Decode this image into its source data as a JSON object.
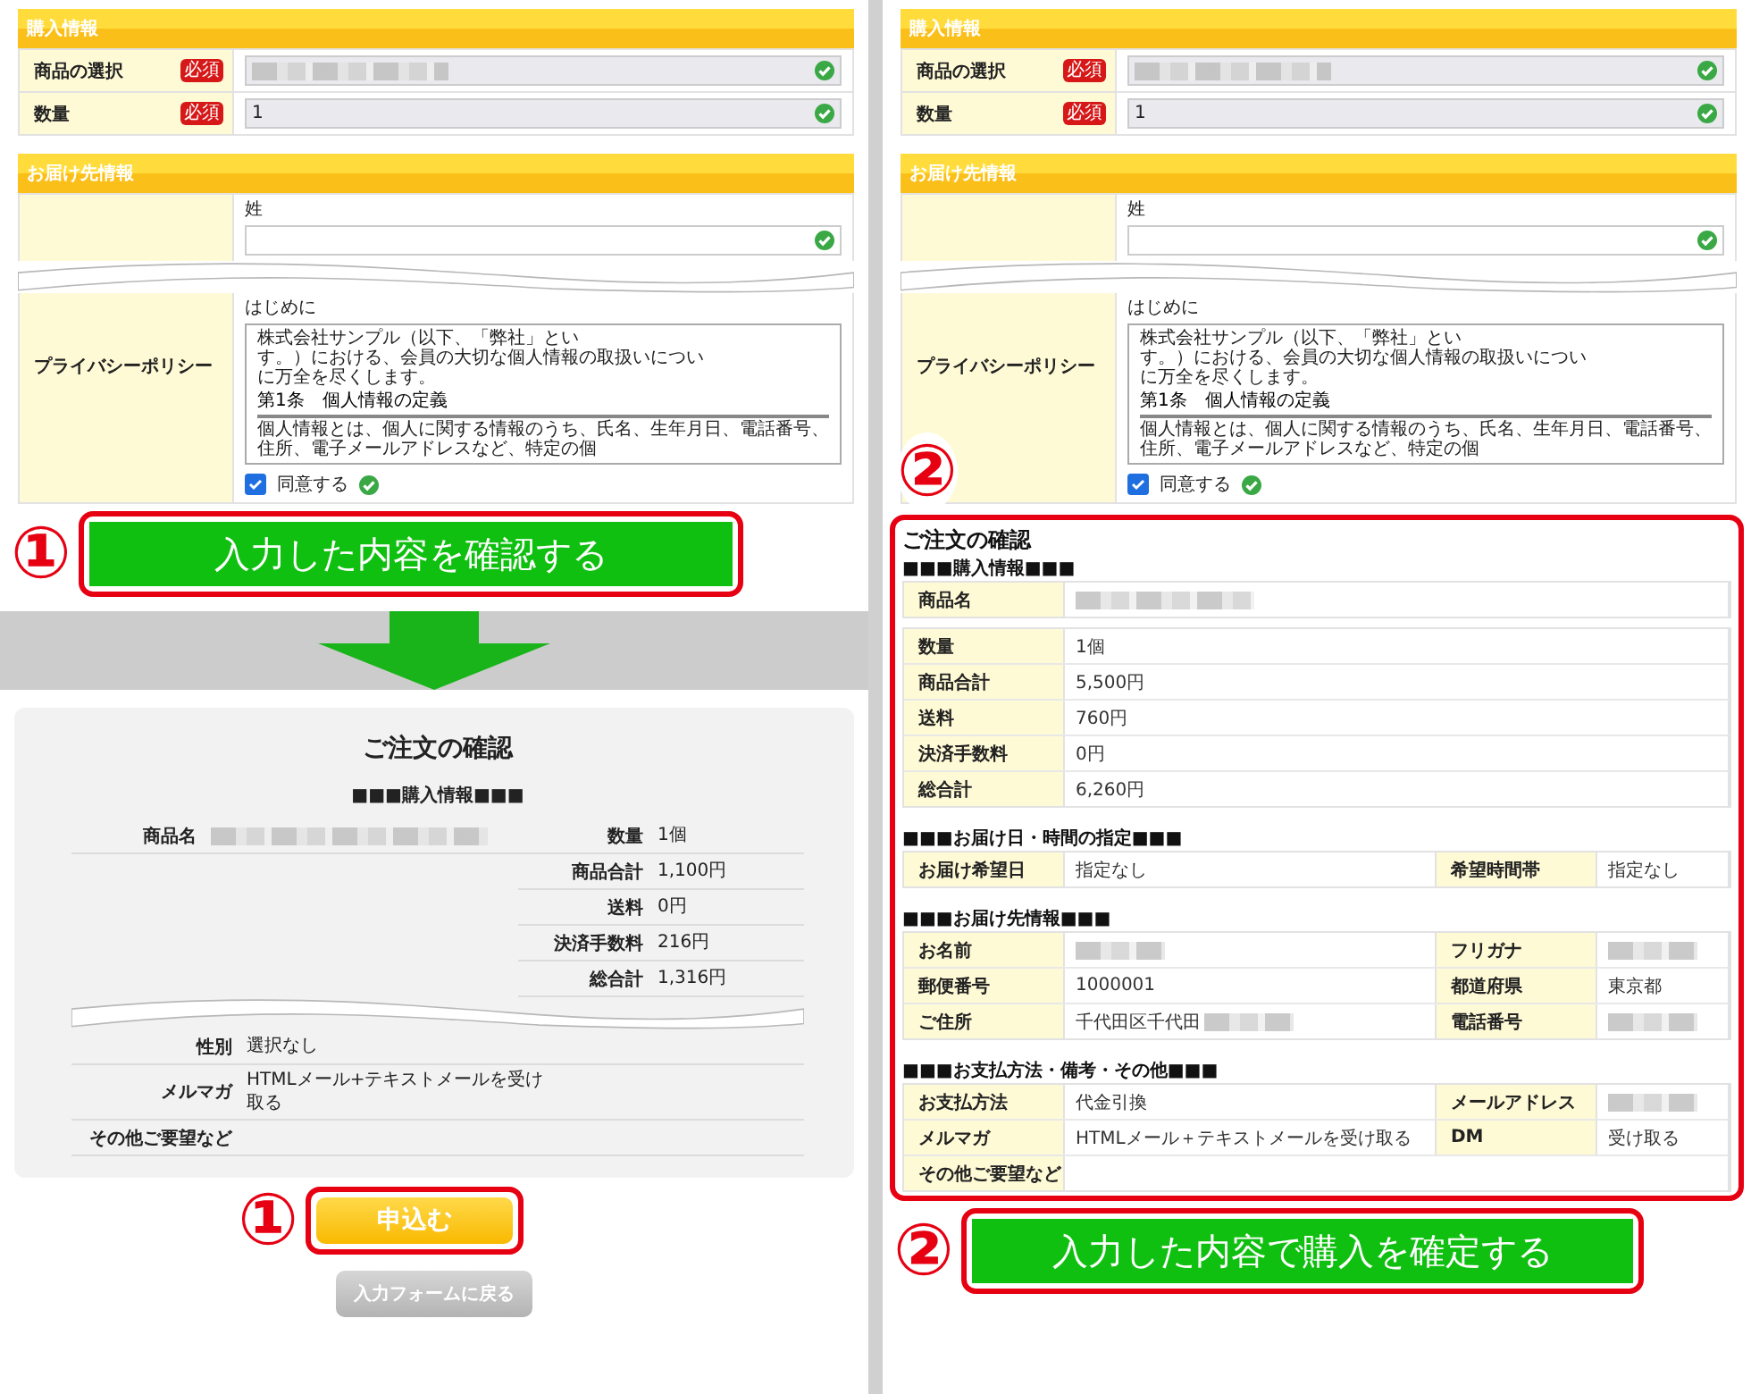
{
  "left_panel": {
    "form": {
      "purchase": {
        "title": "購入情報",
        "fields": [
          {
            "kind": "blurred",
            "label": "商品の選択",
            "badge": "必須"
          },
          {
            "kind": "text",
            "label": "数量",
            "badge": "必須",
            "value": "1"
          }
        ]
      },
      "delivery": {
        "title": "お届け先情報",
        "name_label": "姓",
        "privacy_label": "プライバシーポリシー",
        "policy": {
          "heading": "はじめに",
          "intro_lines": [
            "株式会社サンプル（以下、「弊社」とい",
            "す。）における、会員の大切な個人情報の取扱いについ",
            "に万全を尽くします。"
          ],
          "article": "第1条　個人情報の定義",
          "article_text": "個人情報とは、個人に関する情報のうち、氏名、生年月日、電話番号、住所、電子メールアドレスなど、特定の個"
        },
        "agree": {
          "label": "同意する",
          "checked": true
        }
      }
    },
    "confirm_button": {
      "step": "①",
      "label": "入力した内容を確認する"
    },
    "preview": {
      "title": "ご注文の確認",
      "section": "■■■購入情報■■■",
      "product": {
        "label": "商品名",
        "blurred": true
      },
      "totals": [
        {
          "label": "数量",
          "value": "1個"
        },
        {
          "label": "商品合計",
          "value": "1,100円"
        },
        {
          "label": "送料",
          "value": "0円"
        },
        {
          "label": "決済手数料",
          "value": "216円"
        },
        {
          "label": "総合計",
          "value": "1,316円"
        }
      ],
      "details": [
        {
          "label": "性別",
          "value": "選択なし"
        },
        {
          "label": "メルマガ",
          "value": "HTMLメール+テキストメールを受け取る"
        },
        {
          "label": "その他ご要望など"
        }
      ]
    },
    "submit_button": {
      "step": "①",
      "label": "申込む"
    },
    "back_button": {
      "label": "入力フォームに戻る"
    }
  },
  "right_panel": {
    "form": {
      "purchase": {
        "title": "購入情報",
        "fields": [
          {
            "kind": "blurred",
            "label": "商品の選択",
            "badge": "必須"
          },
          {
            "kind": "text",
            "label": "数量",
            "badge": "必須",
            "value": "1"
          }
        ]
      },
      "delivery": {
        "title": "お届け先情報",
        "name_label": "姓",
        "privacy_label": "プライバシーポリシー",
        "policy": {
          "heading": "はじめに",
          "intro_lines": [
            "株式会社サンプル（以下、「弊社」とい",
            "す。）における、会員の大切な個人情報の取扱いについ",
            "に万全を尽くします。"
          ],
          "article": "第1条　個人情報の定義",
          "article_text": "個人情報とは、個人に関する情報のうち、氏名、生年月日、電話番号、住所、電子メールアドレスなど、特定の個"
        },
        "agree": {
          "label": "同意する",
          "checked": true
        }
      }
    },
    "step": "②",
    "confirm": {
      "title": "ご注文の確認",
      "sections": [
        {
          "heading": "■■■購入情報■■■",
          "tables": [
            [
              [
                {
                  "label": "商品名",
                  "blurred": true
                }
              ]
            ],
            [
              [
                {
                  "label": "数量",
                  "value": "1個"
                }
              ],
              [
                {
                  "label": "商品合計",
                  "value": "5,500円"
                }
              ],
              [
                {
                  "label": "送料",
                  "value": "760円"
                }
              ],
              [
                {
                  "label": "決済手数料",
                  "value": "0円"
                }
              ],
              [
                {
                  "label": "総合計",
                  "value": "6,260円"
                }
              ]
            ]
          ]
        },
        {
          "heading": "■■■お届け日・時間の指定■■■",
          "tables": [
            [
              [
                {
                  "label": "お届け希望日",
                  "value": "指定なし"
                },
                {
                  "label": "希望時間帯",
                  "value": "指定なし"
                }
              ]
            ]
          ]
        },
        {
          "heading": "■■■お届け先情報■■■",
          "tables": [
            [
              [
                {
                  "label": "お名前",
                  "blurred": true
                },
                {
                  "label": "フリガナ",
                  "blurred": true
                }
              ],
              [
                {
                  "label": "郵便番号",
                  "value": "1000001"
                },
                {
                  "label": "都道府県",
                  "value": "東京都"
                }
              ],
              [
                {
                  "label": "ご住所",
                  "value": "千代田区千代田",
                  "blurred": true
                },
                {
                  "label": "電話番号",
                  "blurred": true
                }
              ]
            ]
          ]
        },
        {
          "heading": "■■■お支払方法・備考・その他■■■",
          "tables": [
            [
              [
                {
                  "label": "お支払方法",
                  "value": "代金引換"
                },
                {
                  "label": "メールアドレス",
                  "blurred": true
                }
              ],
              [
                {
                  "label": "メルマガ",
                  "value": "HTMLメール＋テキストメールを受け取る"
                },
                {
                  "label": "DM",
                  "value": "受け取る"
                }
              ],
              [
                {
                  "label": "その他ご要望など"
                }
              ]
            ]
          ]
        }
      ]
    },
    "purchase_button": {
      "step": "②",
      "label": "入力した内容で購入を確定する"
    }
  }
}
